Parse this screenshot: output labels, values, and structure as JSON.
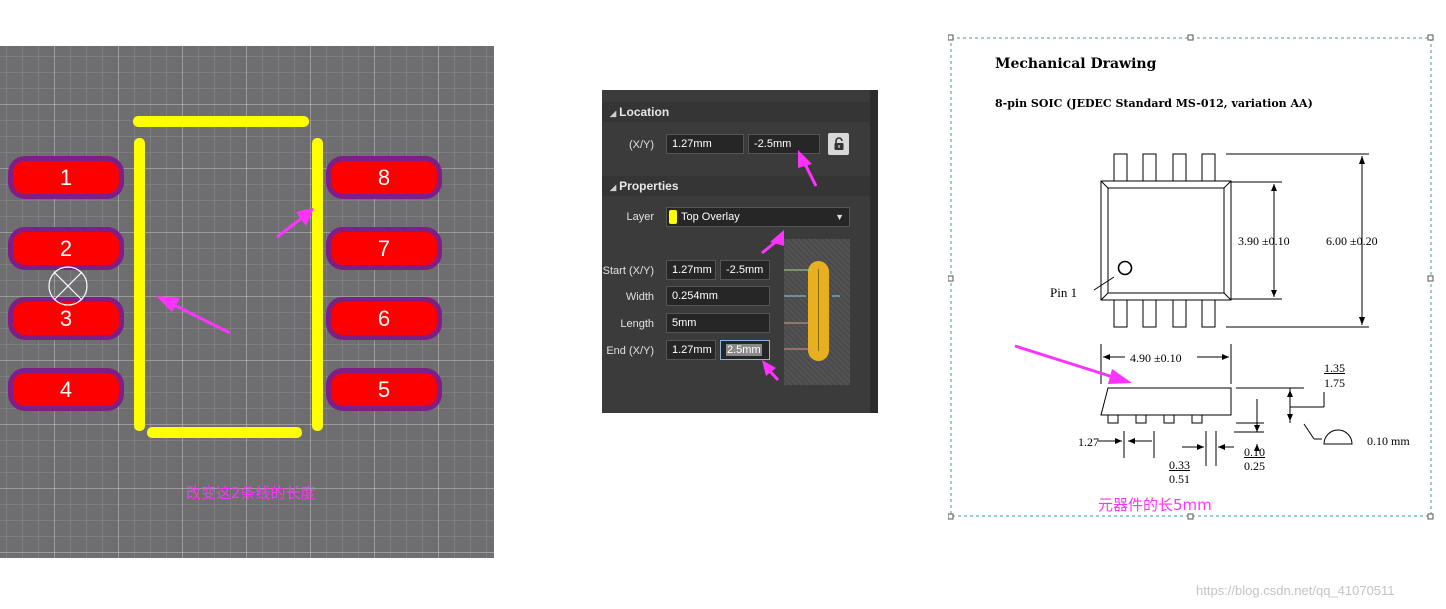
{
  "pcb": {
    "pads_left": [
      "1",
      "2",
      "3",
      "4"
    ],
    "pads_right": [
      "8",
      "7",
      "6",
      "5"
    ],
    "note": "改变这2条线的长度"
  },
  "properties_panel": {
    "location": {
      "header": "Location",
      "xy_label": "(X/Y)",
      "x_value": "1.27mm",
      "y_value": "-2.5mm",
      "lock_icon": "unlock-icon"
    },
    "properties": {
      "header": "Properties",
      "layer_label": "Layer",
      "layer_value": "Top Overlay",
      "layer_color": "#ffff00",
      "start_label": "Start (X/Y)",
      "start_x": "1.27mm",
      "start_y": "-2.5mm",
      "width_label": "Width",
      "width_value": "0.254mm",
      "length_label": "Length",
      "length_value": "5mm",
      "end_label": "End (X/Y)",
      "end_x": "1.27mm",
      "end_y": "2.5mm"
    }
  },
  "mechanical_drawing": {
    "title": "Mechanical Drawing",
    "subtitle": "8-pin SOIC (JEDEC Standard MS-012, variation AA)",
    "pin1_label": "Pin 1",
    "dim_body_width": "3.90 ±0.10",
    "dim_total_width": "6.00 ±0.20",
    "dim_length": "4.90 ±0.10",
    "dim_pitch": "1.27",
    "dim_lead_width_min": "0.33",
    "dim_lead_width_max": "0.51",
    "dim_standoff_min": "0.10",
    "dim_standoff_max": "0.25",
    "dim_height_min": "1.35",
    "dim_height_max": "1.75",
    "dim_coplanarity": "0.10 mm",
    "note": "元器件的长5mm"
  },
  "watermark": "https://blog.csdn.net/qq_41070511",
  "colors": {
    "annotation": "#ff33ff",
    "pad_fill": "#ff0000",
    "pad_border": "#7d1f86",
    "silkscreen": "#ffff00"
  }
}
